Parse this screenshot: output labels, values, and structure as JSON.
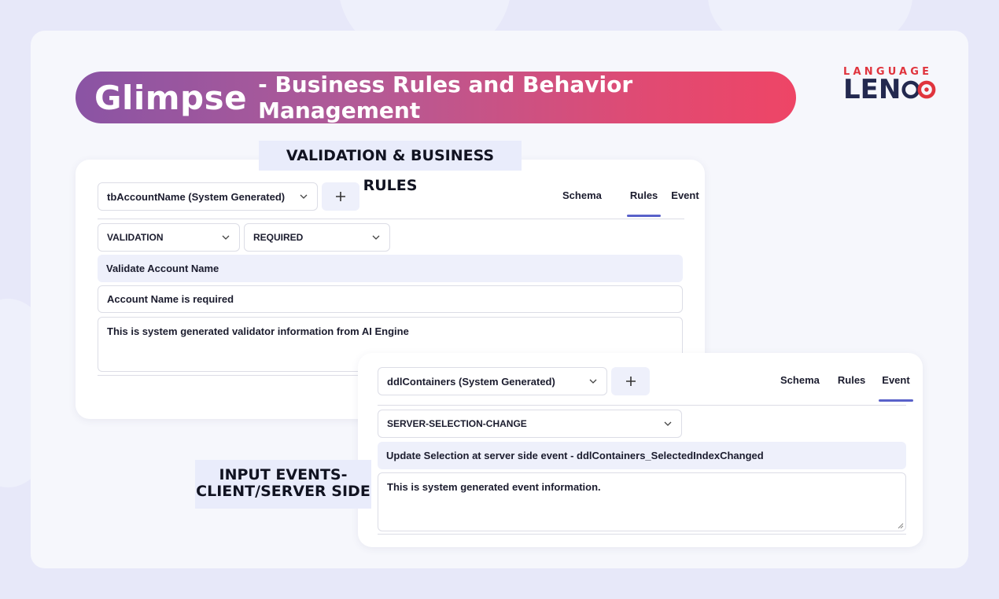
{
  "header": {
    "brand": "Glimpse",
    "subtitle": "- Business Rules and Behavior Management"
  },
  "logo": {
    "top_text": "LANGUAGE",
    "bottom_text": "LEN"
  },
  "colors": {
    "accent_underline": "#5961c9",
    "banner_start": "#8a54a4",
    "banner_end": "#ee4566",
    "logo_red": "#e0343d",
    "logo_navy": "#23294f"
  },
  "section_tags": {
    "validation": "VALIDATION & BUSINESS RULES",
    "events_line1": "INPUT EVENTS-",
    "events_line2": "CLIENT/SERVER SIDE"
  },
  "panel_rules": {
    "control_select": "tbAccountName  (System Generated)",
    "tabs": [
      "Schema",
      "Rules",
      "Event"
    ],
    "active_tab": "Rules",
    "rule_type_select": "VALIDATION",
    "rule_subtype_select": "REQUIRED",
    "rule_name": "Validate Account Name",
    "rule_message": "Account Name is required",
    "rule_description": "This is system generated validator information from AI Engine"
  },
  "panel_events": {
    "control_select": "ddlContainers  (System Generated)",
    "tabs": [
      "Schema",
      "Rules",
      "Event"
    ],
    "active_tab": "Event",
    "event_type_select": "SERVER-SELECTION-CHANGE",
    "event_name": "Update Selection at server side event - ddlContainers_SelectedIndexChanged",
    "event_description": "This is system generated event information."
  },
  "icons": {
    "add": "plus-icon",
    "dropdown": "chevron-down-icon",
    "resize": "resize-handle-icon"
  }
}
